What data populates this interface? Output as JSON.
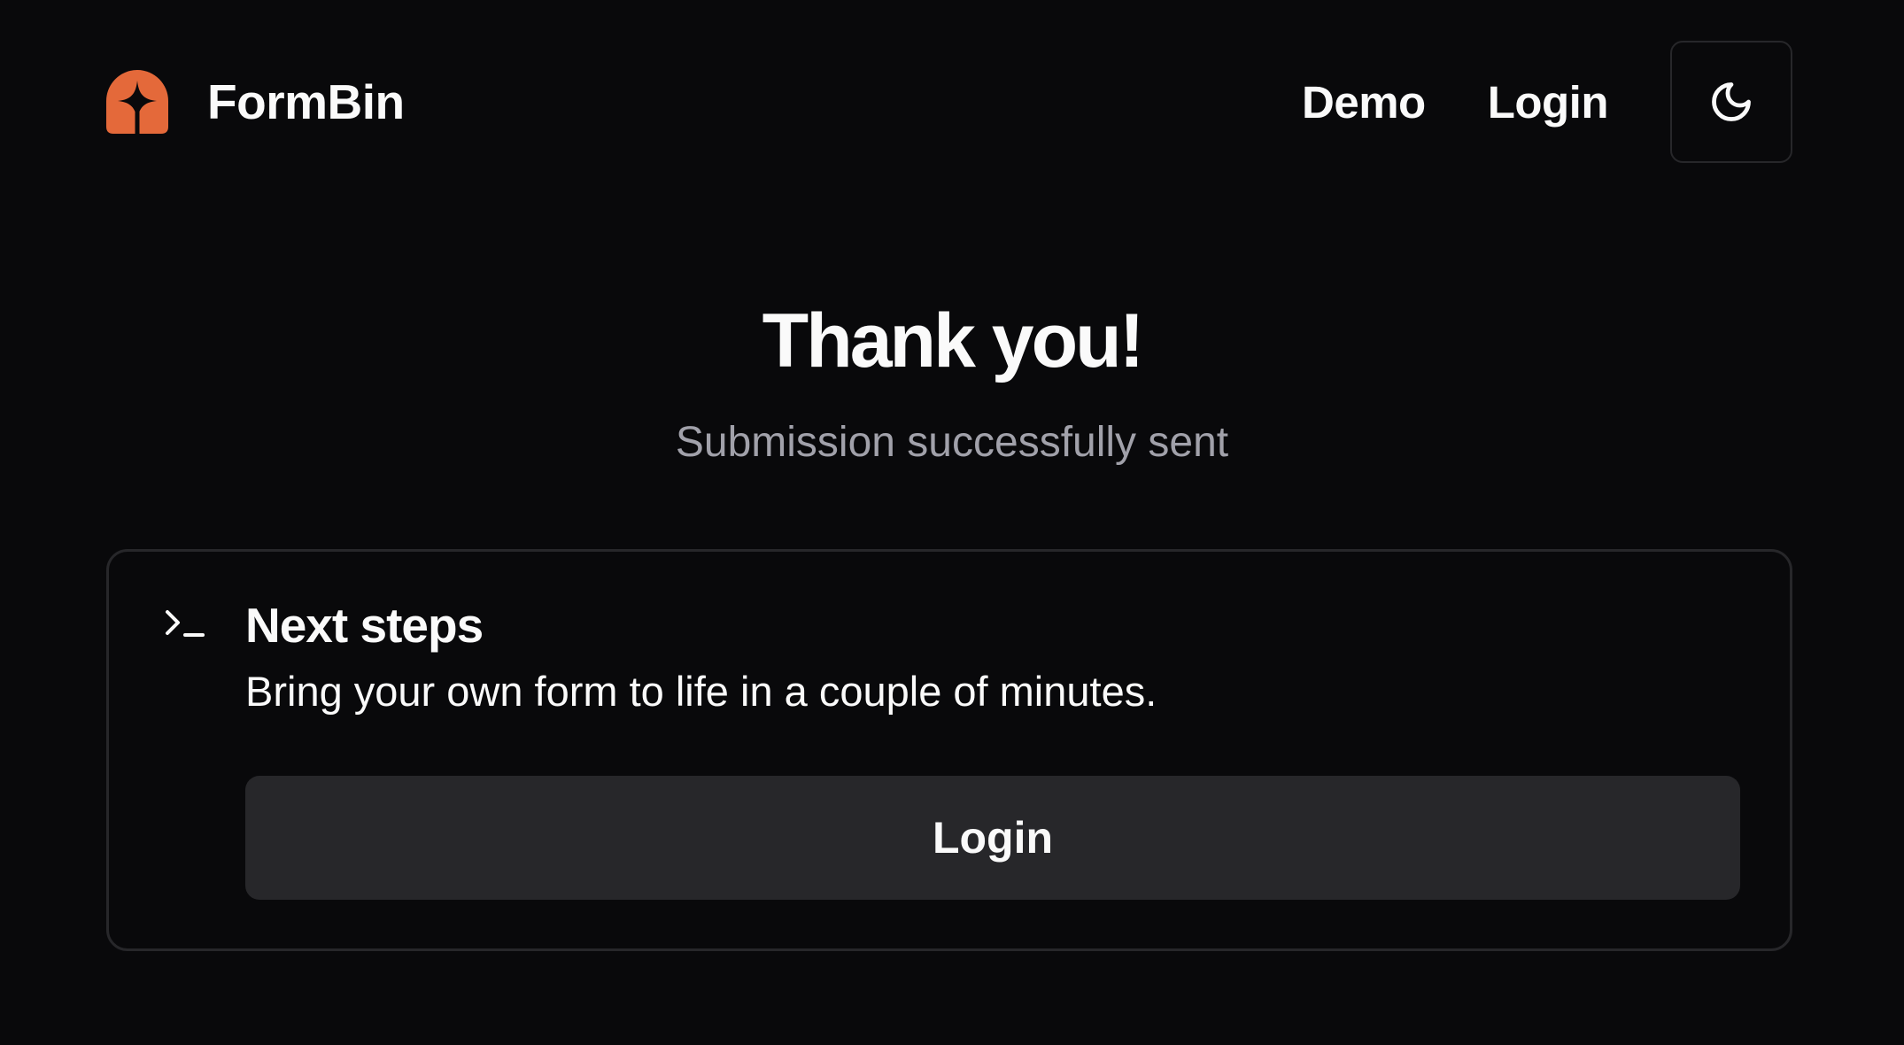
{
  "header": {
    "brand_name": "FormBin",
    "logo_icon": "formbin-logo-icon",
    "nav": {
      "demo_label": "Demo",
      "login_label": "Login"
    },
    "theme_toggle_icon": "moon-icon"
  },
  "hero": {
    "title": "Thank you!",
    "subtitle": "Submission successfully sent"
  },
  "next_steps": {
    "icon": "terminal-icon",
    "title": "Next steps",
    "description": "Bring your own form to life in a couple of minutes.",
    "button_label": "Login"
  },
  "colors": {
    "background": "#09090b",
    "brand_accent": "#e4693a",
    "text_primary": "#fafafa",
    "text_muted": "#a1a1aa",
    "border": "#27272a",
    "button_bg": "#27272a"
  }
}
